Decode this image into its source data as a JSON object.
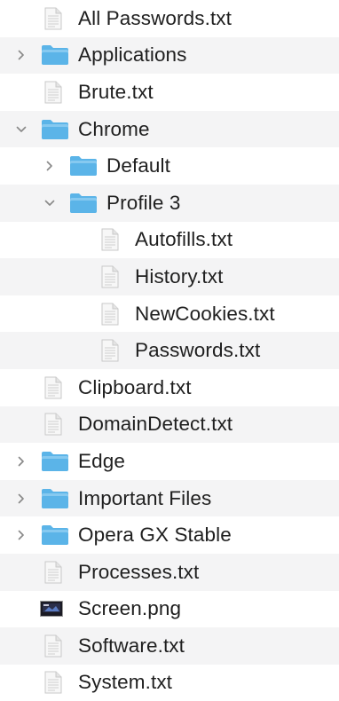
{
  "colors": {
    "row_alt": "#f4f4f5",
    "folder": "#5bb4e8",
    "folder_top": "#86c9f0",
    "chevron": "#8a8a8a"
  },
  "items": [
    {
      "name": "All Passwords.txt",
      "kind": "file",
      "depth": 0
    },
    {
      "name": "Applications",
      "kind": "folder",
      "depth": 0,
      "state": "collapsed"
    },
    {
      "name": "Brute.txt",
      "kind": "file",
      "depth": 0
    },
    {
      "name": "Chrome",
      "kind": "folder",
      "depth": 0,
      "state": "expanded"
    },
    {
      "name": "Default",
      "kind": "folder",
      "depth": 1,
      "state": "collapsed"
    },
    {
      "name": "Profile 3",
      "kind": "folder",
      "depth": 1,
      "state": "expanded"
    },
    {
      "name": "Autofills.txt",
      "kind": "file",
      "depth": 2
    },
    {
      "name": "History.txt",
      "kind": "file",
      "depth": 2
    },
    {
      "name": "NewCookies.txt",
      "kind": "file",
      "depth": 2
    },
    {
      "name": "Passwords.txt",
      "kind": "file",
      "depth": 2
    },
    {
      "name": "Clipboard.txt",
      "kind": "file",
      "depth": 0
    },
    {
      "name": "DomainDetect.txt",
      "kind": "file",
      "depth": 0
    },
    {
      "name": "Edge",
      "kind": "folder",
      "depth": 0,
      "state": "collapsed"
    },
    {
      "name": "Important Files",
      "kind": "folder",
      "depth": 0,
      "state": "collapsed"
    },
    {
      "name": "Opera GX Stable",
      "kind": "folder",
      "depth": 0,
      "state": "collapsed"
    },
    {
      "name": "Processes.txt",
      "kind": "file",
      "depth": 0
    },
    {
      "name": "Screen.png",
      "kind": "image",
      "depth": 0
    },
    {
      "name": "Software.txt",
      "kind": "file",
      "depth": 0
    },
    {
      "name": "System.txt",
      "kind": "file",
      "depth": 0
    }
  ]
}
